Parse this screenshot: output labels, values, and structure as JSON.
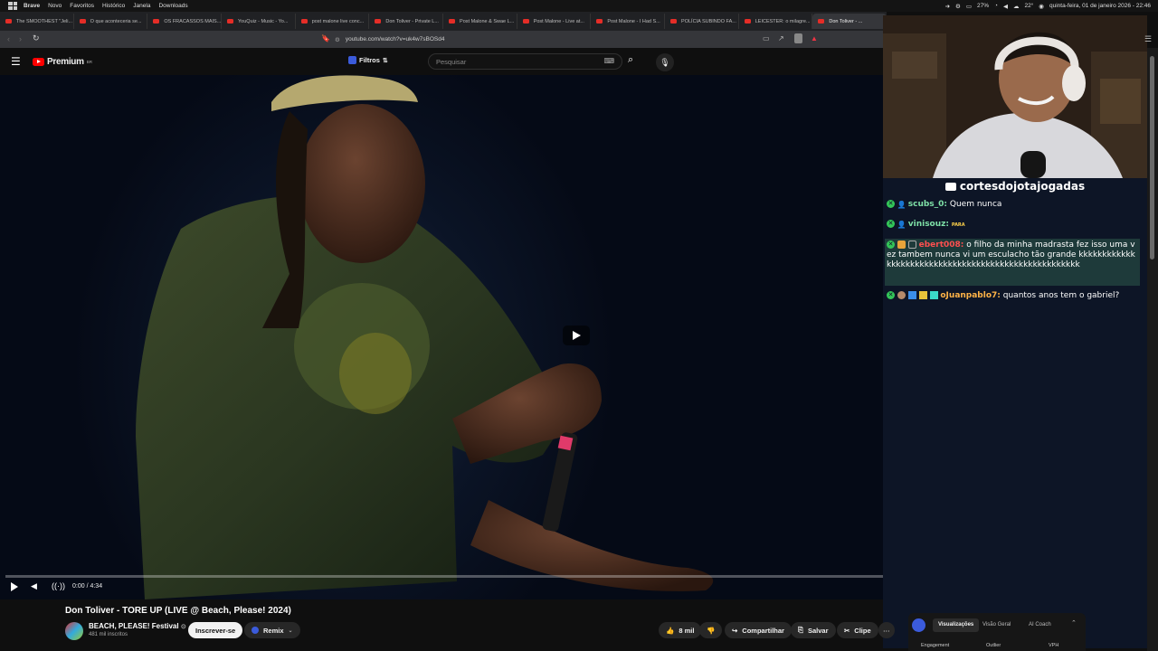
{
  "menubar": {
    "app": "Brave",
    "items": [
      "Novo",
      "Favoritos",
      "Histórico",
      "Janela",
      "Downloads"
    ],
    "battery": "27%",
    "temperature": "22°",
    "datetime": "quinta-feira, 01 de janeiro 2026 - 22:46"
  },
  "tabs": [
    {
      "label": "The SMOOTHEST \"Jeli...",
      "active": false
    },
    {
      "label": "O que aconteceria se...",
      "active": false
    },
    {
      "label": "OS FRACASSOS MAIS...",
      "active": false
    },
    {
      "label": "YouQuiz - Music - Yo...",
      "active": false
    },
    {
      "label": "post malone live conc...",
      "active": false
    },
    {
      "label": "Don Toliver - Private L...",
      "active": false
    },
    {
      "label": "Post Malone & Swae L...",
      "active": false
    },
    {
      "label": "Post Malone - Live at...",
      "active": false
    },
    {
      "label": "Post Malone - I Had S...",
      "active": false
    },
    {
      "label": "POLÍCIA SUBINDO FA...",
      "active": false
    },
    {
      "label": "LEICESTER: o milagre...",
      "active": false
    },
    {
      "label": "Don Toliver - ...",
      "active": true
    }
  ],
  "address": {
    "url": "youtube.com/watch?v=uk4w7sBOSd4"
  },
  "youtube": {
    "logo": "Premium",
    "logo_badge": "BR",
    "filters_label": "Filtros",
    "search_placeholder": "Pesquisar"
  },
  "player": {
    "time": "0:00 / 4:34",
    "progress": 0.0
  },
  "video_info": {
    "title": "Don Toliver - TORE UP (LIVE @ Beach, Please! 2024)",
    "channel": "BEACH, PLEASE! Festival",
    "subscribers": "481 mil inscritos",
    "subscribe_label": "Inscrever-se",
    "remix_label": "Remix",
    "likes": "8 mil",
    "share_label": "Compartilhar",
    "save_label": "Salvar",
    "clip_label": "Clipe"
  },
  "extension_panel": {
    "tabs": [
      "Visualizações",
      "Visão Geral",
      "AI Coach"
    ],
    "columns": [
      "Engagement",
      "Outlier",
      "VPH"
    ]
  },
  "stream": {
    "channel_name": "cortesdojotajogadas",
    "chat": [
      {
        "user": "scubs_0:",
        "message": "Quem nunca",
        "user_color": "#7ee0a7"
      },
      {
        "user": "vinisouz:",
        "message": "PARA",
        "user_color": "#7ee0a7"
      },
      {
        "user": "ebert008:",
        "message": "o filho da minha madrasta fez isso uma vez tambem nunca vi um esculacho tão grande kkkkkkkkkkkkkkkkkkkkkkkkkkkkkkkkkkkkkkkkkkkkkkkkkkkkk",
        "user_color": "#ff4f4f"
      },
      {
        "user": "oJuanpablo7:",
        "message": "quantos anos tem o gabriel?",
        "user_color": "#ffb347"
      }
    ]
  },
  "colors": {
    "youtube_red": "#ff0000",
    "chat_bg": "#0d1526",
    "highlight": "#1e3a3a"
  }
}
